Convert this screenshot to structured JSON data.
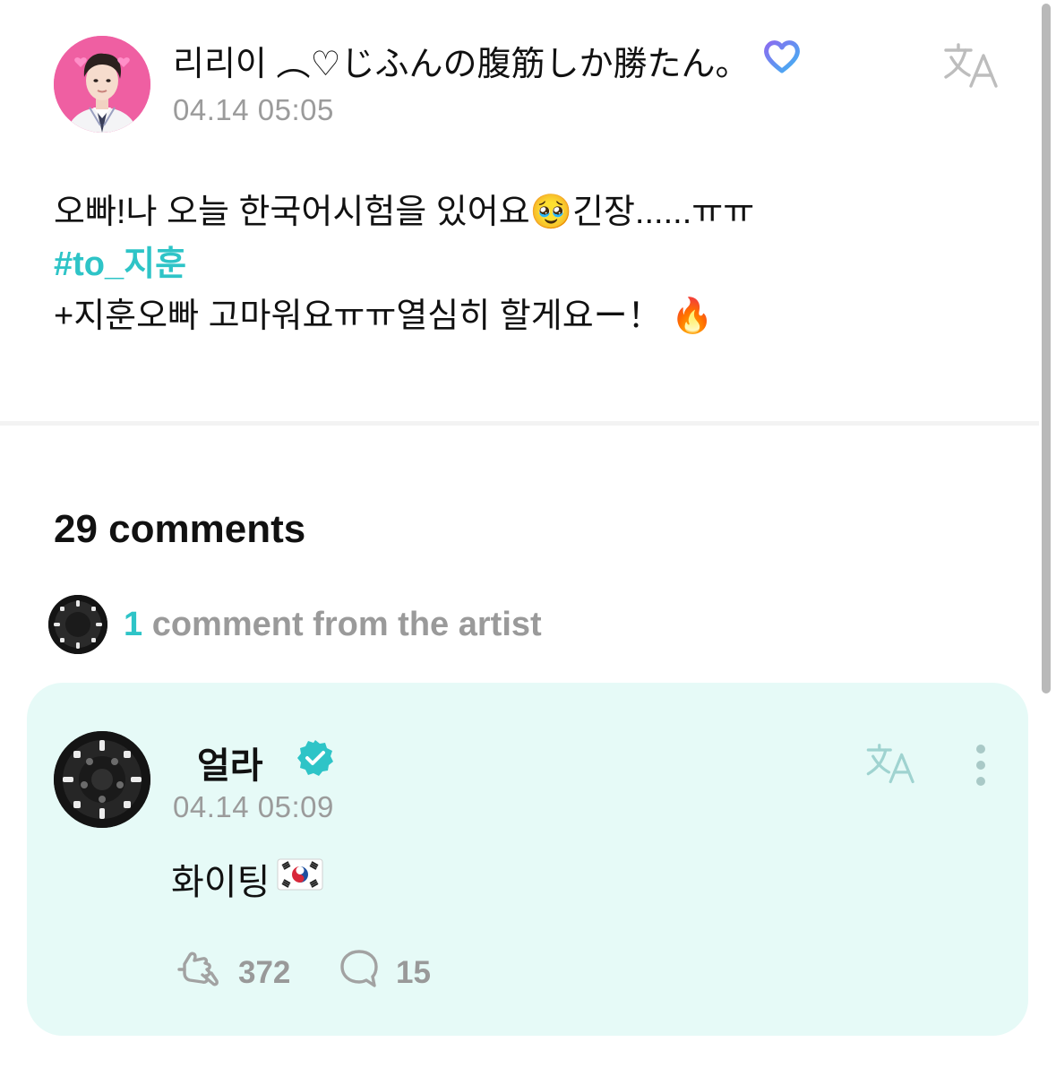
{
  "post": {
    "username": "리리이 ︵♡じふんの腹筋しか勝たん。",
    "membership_icon": "heart-membership-icon",
    "timestamp": "04.14 05:05",
    "translate_icon": "translate-icon",
    "body": {
      "line1_text": "오빠!나 오늘 한국어시험을 있어요",
      "line1_emoji": "🥹",
      "line1_tail": "긴장......ㅠㅠ",
      "hashtag": "#to_지훈",
      "line3_text": "+지훈오빠 고마워요ㅠㅠ열심히 할게요ー！",
      "line3_emoji": "🔥"
    }
  },
  "comments": {
    "count_label": "29 comments",
    "artist_summary": {
      "count": "1",
      "label": "comment from the artist"
    }
  },
  "artist_comment": {
    "name": "얼라",
    "verified_icon": "verified-badge-icon",
    "timestamp": "04.14 05:09",
    "text": "화이팅",
    "text_emoji": "🇰🇷",
    "likes": "372",
    "replies": "15",
    "colors": {
      "card_background": "#e6faf7",
      "accent": "#2ec4c7"
    }
  }
}
